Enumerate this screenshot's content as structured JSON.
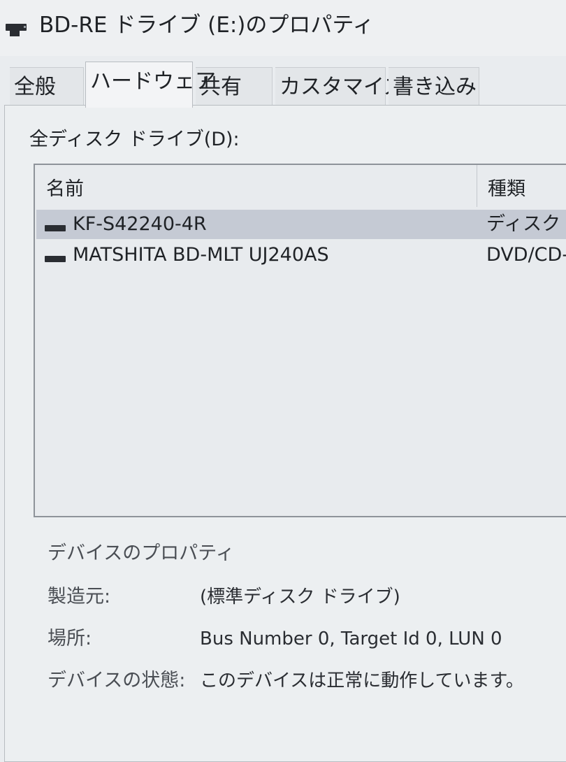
{
  "window": {
    "title": "BD-RE ドライブ (E:)のプロパティ",
    "icon": "optical-drive-icon"
  },
  "tabs": [
    {
      "label": "全般",
      "active": false
    },
    {
      "label": "ハードウェア",
      "active": true
    },
    {
      "label": "共有",
      "active": false
    },
    {
      "label": "カスタマイズ",
      "active": false
    },
    {
      "label": "書き込み",
      "active": false
    }
  ],
  "hardware": {
    "section_label": "全ディスク ドライブ(D):",
    "columns": {
      "name": "名前",
      "type": "種類"
    },
    "devices": [
      {
        "name": "KF-S42240-4R",
        "type": "ディスク ド",
        "icon": "drive-icon",
        "selected": true
      },
      {
        "name": "MATSHITA BD-MLT UJ240AS",
        "type": "DVD/CD-",
        "icon": "drive-icon",
        "selected": false
      }
    ]
  },
  "properties": {
    "title": "デバイスのプロパティ",
    "manufacturer_label": "製造元:",
    "manufacturer_value": "(標準ディスク ドライブ)",
    "location_label": "場所:",
    "location_value": "Bus Number 0, Target Id 0, LUN 0",
    "status_label": "デバイスの状態:",
    "status_value": "このデバイスは正常に動作しています。"
  }
}
